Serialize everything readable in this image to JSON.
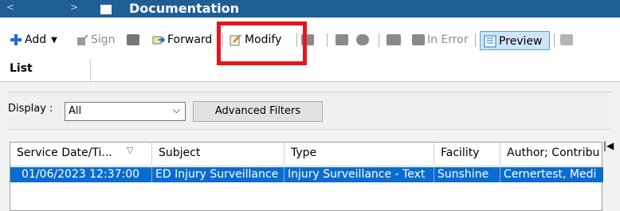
{
  "titlebar": {
    "title": "Documentation",
    "back": "<",
    "forward": ">"
  },
  "toolbar": {
    "add_label": "Add",
    "add_caret": "▼",
    "sign_label": "Sign",
    "forward_label": "Forward",
    "modify_label": "Modify",
    "in_error_label": "In Error",
    "preview_label": "Preview"
  },
  "tabs": [
    {
      "label": "List"
    }
  ],
  "filters": {
    "display_label": "Display :",
    "display_value": "All",
    "advanced_filters_label": "Advanced Filters"
  },
  "table": {
    "columns": [
      "Service Date/Ti...",
      "Subject",
      "Type",
      "Facility",
      "Author; Contribu"
    ],
    "sort_glyph": "▽",
    "rows": [
      [
        "01/06/2023 12:37:00",
        "ED Injury Surveillance",
        "Injury Surveillance - Text",
        "Sunshine",
        "Cernertest, Medi"
      ]
    ]
  },
  "colors": {
    "titlebar": "#1f5f96",
    "selection": "#0b6cd0",
    "highlight": "#e8141c",
    "add_icon": "#1a73c8"
  }
}
